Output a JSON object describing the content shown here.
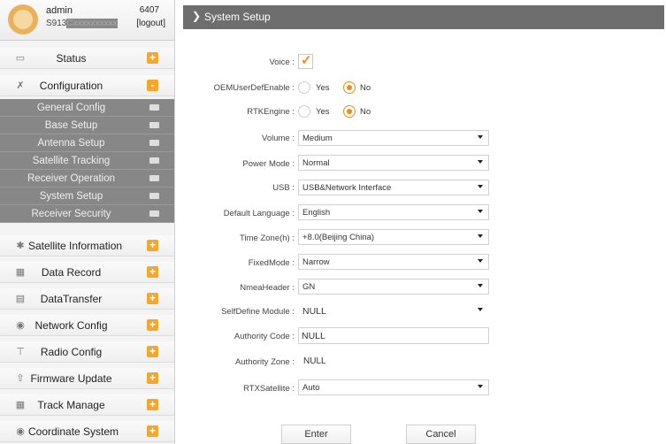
{
  "user": {
    "name": "admin",
    "serial_visible": "S913",
    "serial_masked": "Cxxxxxxxxxx",
    "count": "6407",
    "logout": "[logout]"
  },
  "sidebar": {
    "items": [
      {
        "label": "Status",
        "icon": "monitor-icon",
        "expander": "+"
      },
      {
        "label": "Configuration",
        "icon": "tools-icon",
        "expander": "-"
      },
      {
        "label": "Satellite Information",
        "icon": "satellite-icon",
        "expander": "+"
      },
      {
        "label": "Data Record",
        "icon": "calendar-icon",
        "expander": "+"
      },
      {
        "label": "DataTransfer",
        "icon": "computer-icon",
        "expander": "+"
      },
      {
        "label": "Network Config",
        "icon": "globe-icon",
        "expander": "+"
      },
      {
        "label": "Radio Config",
        "icon": "antenna-icon",
        "expander": "+"
      },
      {
        "label": "Firmware Update",
        "icon": "upload-icon",
        "expander": "+"
      },
      {
        "label": "Track Manage",
        "icon": "calendar-icon",
        "expander": "+"
      },
      {
        "label": "Coordinate System",
        "icon": "globe-icon",
        "expander": "+"
      }
    ],
    "submenu": [
      "General Config",
      "Base Setup",
      "Antenna Setup",
      "Satellite Tracking",
      "Receiver Operation",
      "System Setup",
      "Receiver Security"
    ]
  },
  "header": {
    "title": "System Setup"
  },
  "form": {
    "voice": {
      "label": "Voice :",
      "checked": true
    },
    "oem": {
      "label": "OEMUserDefEnable :",
      "yes": "Yes",
      "no": "No",
      "selected": "No"
    },
    "rtk": {
      "label": "RTKEngine :",
      "yes": "Yes",
      "no": "No",
      "selected": "No"
    },
    "volume": {
      "label": "Volume :",
      "value": "Medium"
    },
    "power_mode": {
      "label": "Power Mode :",
      "value": "Normal"
    },
    "usb": {
      "label": "USB :",
      "value": "USB&Network Interface"
    },
    "default_language": {
      "label": "Default Language :",
      "value": "English"
    },
    "time_zone": {
      "label": "Time Zone(h) :",
      "value": "+8.0(Beijing China)"
    },
    "fixed_mode": {
      "label": "FixedMode :",
      "value": "Narrow"
    },
    "nmea_header": {
      "label": "NmeaHeader :",
      "value": "GN"
    },
    "self_define_module": {
      "label": "SelfDefine Module :",
      "value": "NULL"
    },
    "authority_code": {
      "label": "Authority Code :",
      "value": "NULL"
    },
    "authority_zone": {
      "label": "Authority Zone :",
      "value": "NULL"
    },
    "rtx_satellite": {
      "label": "RTXSatellite :",
      "value": "Auto"
    }
  },
  "buttons": {
    "enter": "Enter",
    "cancel": "Cancel"
  },
  "colors": {
    "accent": "#f08a1c",
    "header_bg": "#6e6e6e",
    "submenu_bg": "#878787"
  }
}
